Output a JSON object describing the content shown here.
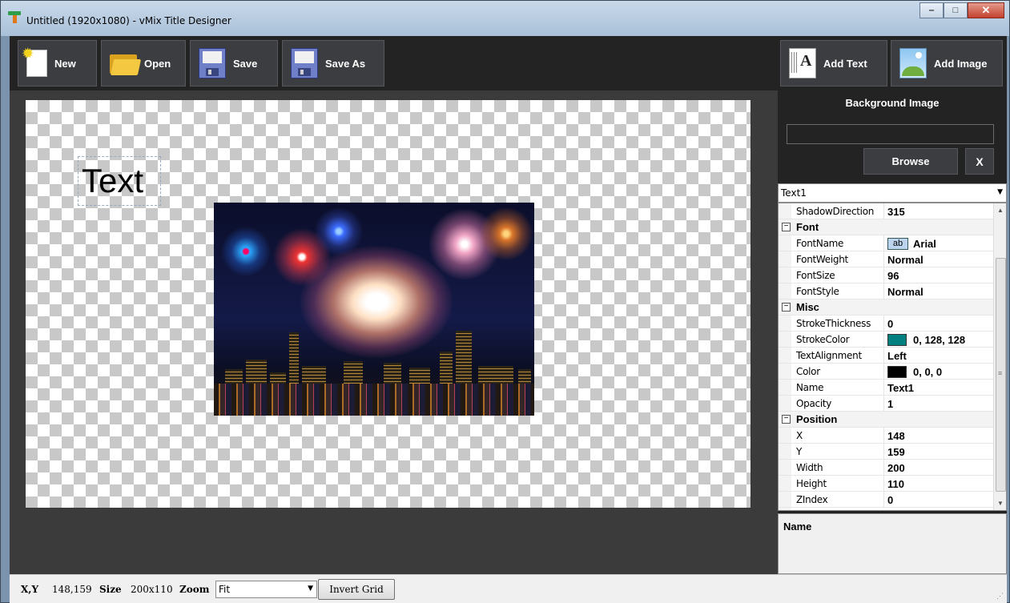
{
  "window": {
    "title": "Untitled (1920x1080) - vMix Title Designer"
  },
  "toolbar": {
    "new_label": "New",
    "open_label": "Open",
    "save_label": "Save",
    "save_as_label": "Save As",
    "add_text_label": "Add Text",
    "add_image_label": "Add Image"
  },
  "canvas": {
    "text_object": "Text"
  },
  "background_image": {
    "title": "Background Image",
    "path_value": "",
    "browse_label": "Browse",
    "clear_label": "X"
  },
  "object_selector": {
    "selected": "Text1"
  },
  "properties": {
    "rows": [
      {
        "type": "prop",
        "name": "ShadowDirection",
        "value": "315"
      },
      {
        "type": "cat",
        "name": "Font"
      },
      {
        "type": "prop",
        "name": "FontName",
        "value": "Arial",
        "badge": "ab"
      },
      {
        "type": "prop",
        "name": "FontWeight",
        "value": "Normal"
      },
      {
        "type": "prop",
        "name": "FontSize",
        "value": "96"
      },
      {
        "type": "prop",
        "name": "FontStyle",
        "value": "Normal"
      },
      {
        "type": "cat",
        "name": "Misc"
      },
      {
        "type": "prop",
        "name": "StrokeThickness",
        "value": "0"
      },
      {
        "type": "prop",
        "name": "StrokeColor",
        "value": "0, 128, 128",
        "swatch": "#008080"
      },
      {
        "type": "prop",
        "name": "TextAlignment",
        "value": "Left"
      },
      {
        "type": "prop",
        "name": "Color",
        "value": "0, 0, 0",
        "swatch": "#000000"
      },
      {
        "type": "prop",
        "name": "Name",
        "value": "Text1"
      },
      {
        "type": "prop",
        "name": "Opacity",
        "value": "1"
      },
      {
        "type": "cat",
        "name": "Position"
      },
      {
        "type": "prop",
        "name": "X",
        "value": "148"
      },
      {
        "type": "prop",
        "name": "Y",
        "value": "159"
      },
      {
        "type": "prop",
        "name": "Width",
        "value": "200"
      },
      {
        "type": "prop",
        "name": "Height",
        "value": "110"
      },
      {
        "type": "prop",
        "name": "ZIndex",
        "value": "0"
      }
    ]
  },
  "description": {
    "title": "Name"
  },
  "statusbar": {
    "xy_label": "X,Y",
    "xy_value": "148,159",
    "size_label": "Size",
    "size_value": "200x110",
    "zoom_label": "Zoom",
    "zoom_value": "Fit",
    "invert_grid_label": "Invert Grid"
  },
  "colors": {
    "toolbar_bg": "#232323",
    "button_bg": "#3b3d40",
    "stroke_color": "#008080"
  },
  "icons": {
    "new": "new-document-icon",
    "open": "folder-icon",
    "save": "floppy-disk-icon",
    "save_as": "floppy-disk-icon",
    "add_text": "add-text-icon",
    "add_image": "add-image-icon"
  }
}
